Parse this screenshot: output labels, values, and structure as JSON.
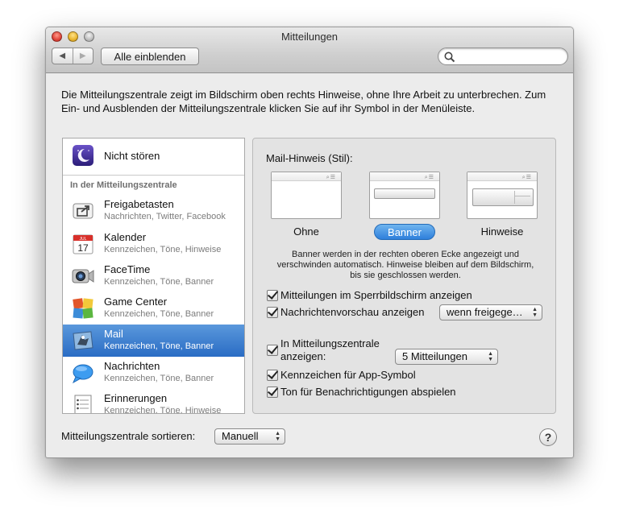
{
  "window": {
    "title": "Mitteilungen"
  },
  "toolbar": {
    "back_glyph": "◀",
    "forward_glyph": "▶",
    "show_all_label": "Alle einblenden",
    "search_placeholder": ""
  },
  "intro_text": "Die Mitteilungszentrale zeigt im Bildschirm oben rechts Hinweise, ohne Ihre Arbeit zu unterbrechen. Zum Ein- und Ausblenden der Mitteilungszentrale klicken Sie auf ihr Symbol in der Menüleiste.",
  "sidebar": {
    "dnd_label": "Nicht stören",
    "section_header": "In der Mitteilungszentrale",
    "items": [
      {
        "name": "Freigabetasten",
        "sub": "Nachrichten, Twitter, Facebook",
        "icon": "share-icon"
      },
      {
        "name": "Kalender",
        "sub": "Kennzeichen, Töne, Hinweise",
        "icon": "calendar-icon",
        "calendar_month": "JUL",
        "calendar_day": "17"
      },
      {
        "name": "FaceTime",
        "sub": "Kennzeichen, Töne, Banner",
        "icon": "facetime-icon"
      },
      {
        "name": "Game Center",
        "sub": "Kennzeichen, Töne, Banner",
        "icon": "game-center-icon"
      },
      {
        "name": "Mail",
        "sub": "Kennzeichen, Töne, Banner",
        "icon": "mail-icon",
        "selected": true
      },
      {
        "name": "Nachrichten",
        "sub": "Kennzeichen, Töne, Banner",
        "icon": "messages-icon"
      },
      {
        "name": "Erinnerungen",
        "sub": "Kennzeichen, Töne, Hinweise",
        "icon": "reminders-icon"
      }
    ]
  },
  "detail": {
    "style_title": "Mail-Hinweis (Stil):",
    "styles": [
      {
        "label": "Ohne"
      },
      {
        "label": "Banner",
        "selected": true
      },
      {
        "label": "Hinweise"
      }
    ],
    "description": "Banner werden in der rechten oberen Ecke angezeigt und verschwinden automatisch. Hinweise bleiben auf dem Bildschirm, bis sie geschlossen werden.",
    "lock_screen_label": "Mitteilungen im Sperrbildschirm anzeigen",
    "preview_label": "Nachrichtenvorschau anzeigen",
    "preview_value": "wenn freigege…",
    "in_center_label_line1": "In Mitteilungszentrale",
    "in_center_label_line2": "anzeigen:",
    "in_center_value": "5 Mitteilungen",
    "badge_label": "Kennzeichen für App-Symbol",
    "sound_label": "Ton für Benachrichtigungen abspielen"
  },
  "footer": {
    "sort_label": "Mitteilungszentrale sortieren:",
    "sort_value": "Manuell",
    "help_glyph": "?"
  },
  "colors": {
    "selection": "#2a6cc4",
    "accent": "#2e7fdb"
  }
}
